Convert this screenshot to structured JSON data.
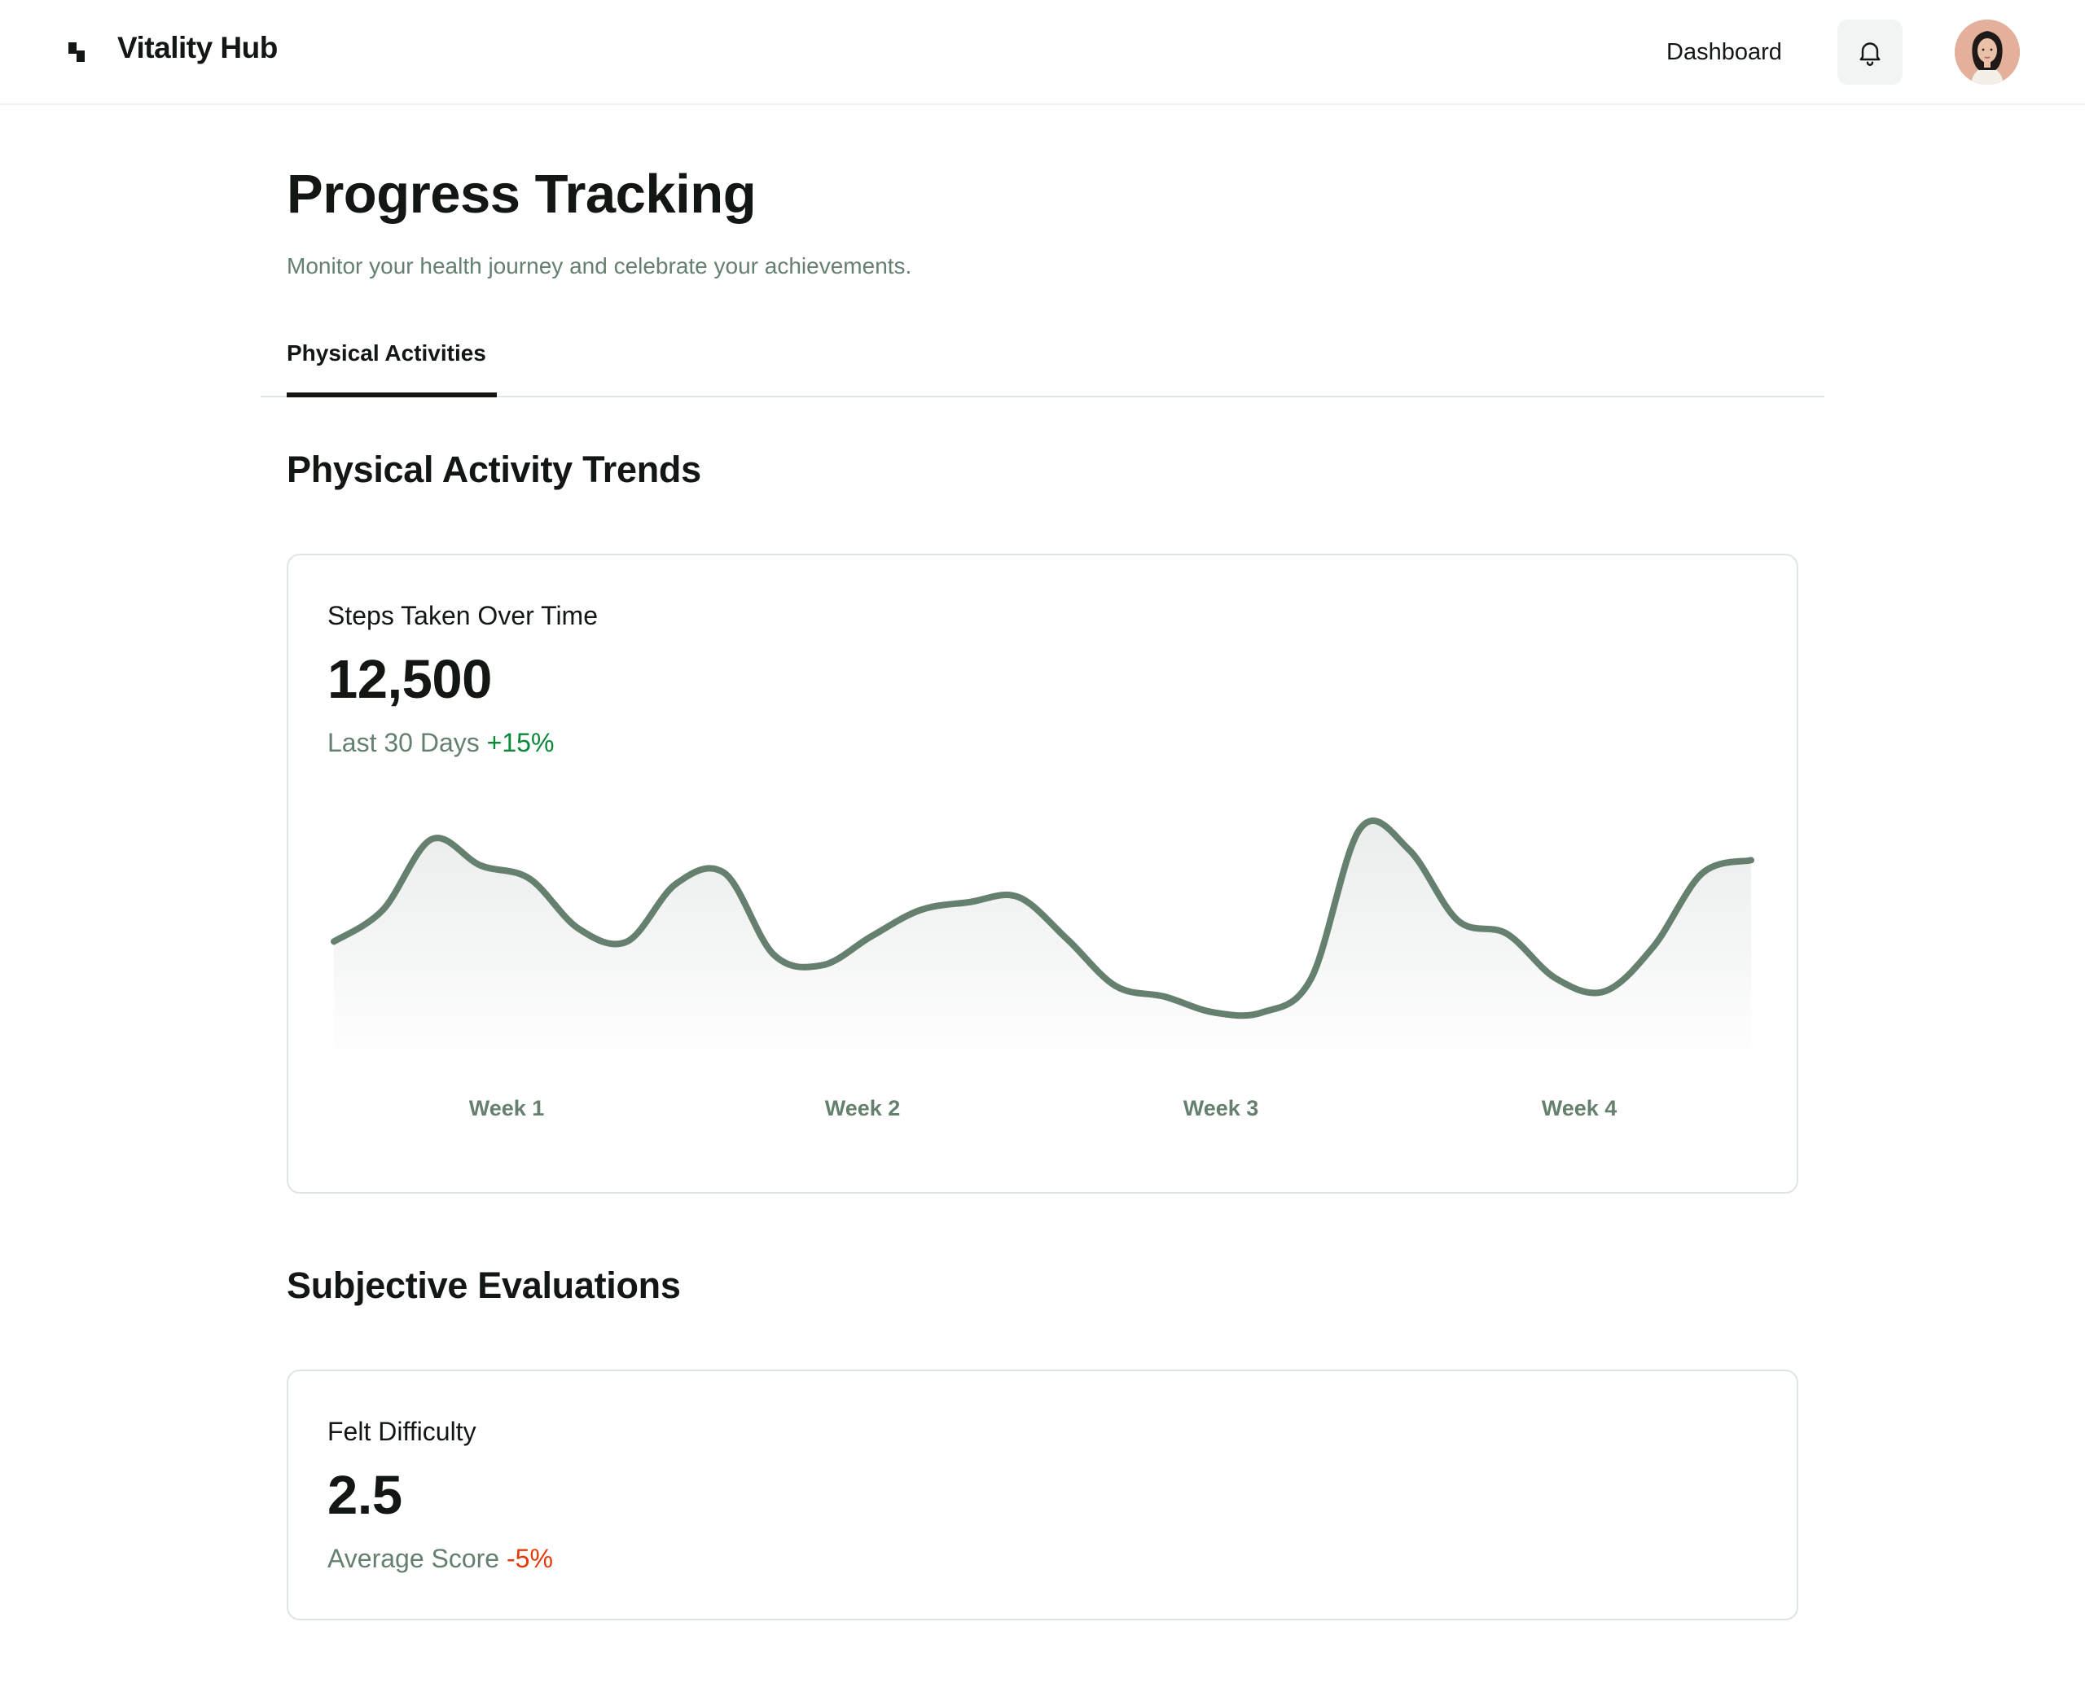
{
  "header": {
    "brand": "Vitality Hub",
    "nav_dashboard": "Dashboard",
    "icons": {
      "logo": "logo-icon",
      "bell": "bell-icon",
      "avatar": "user-avatar"
    }
  },
  "page": {
    "title": "Progress Tracking",
    "subtitle": "Monitor your health journey and celebrate your achievements."
  },
  "tabs": [
    {
      "label": "Physical Activities",
      "active": true
    }
  ],
  "sections": {
    "trends_title": "Physical Activity Trends",
    "evaluations_title": "Subjective Evaluations"
  },
  "steps_card": {
    "label": "Steps Taken Over Time",
    "value": "12,500",
    "period": "Last 30 Days",
    "delta": "+15%"
  },
  "difficulty_card": {
    "label": "Felt Difficulty",
    "value": "2.5",
    "period": "Average Score",
    "delta": "-5%"
  },
  "colors": {
    "accent": "#66806f",
    "text": "#121714",
    "positive": "#078838",
    "negative": "#e73908",
    "border": "#dfe6e2"
  },
  "chart_data": {
    "type": "area",
    "title": "Steps Taken Over Time",
    "categories": [
      "Week 1",
      "Week 2",
      "Week 3",
      "Week 4"
    ],
    "x": [
      0,
      1,
      2,
      3,
      4,
      5,
      6,
      7,
      8,
      9,
      10,
      11,
      12,
      13,
      14,
      15,
      16,
      17,
      18,
      19,
      20,
      21,
      22,
      23,
      24,
      25,
      26,
      27,
      28,
      29
    ],
    "series": [
      {
        "values": [
          109,
          121,
          148,
          138,
          133,
          114,
          109,
          131,
          135,
          104,
          100,
          111,
          121,
          124,
          126,
          110,
          92,
          88,
          82,
          82,
          95,
          152,
          144,
          117,
          112,
          95,
          90,
          107,
          135,
          140
        ]
      }
    ],
    "ylim": [
      70,
      160
    ],
    "grid": false,
    "legend": "none"
  }
}
